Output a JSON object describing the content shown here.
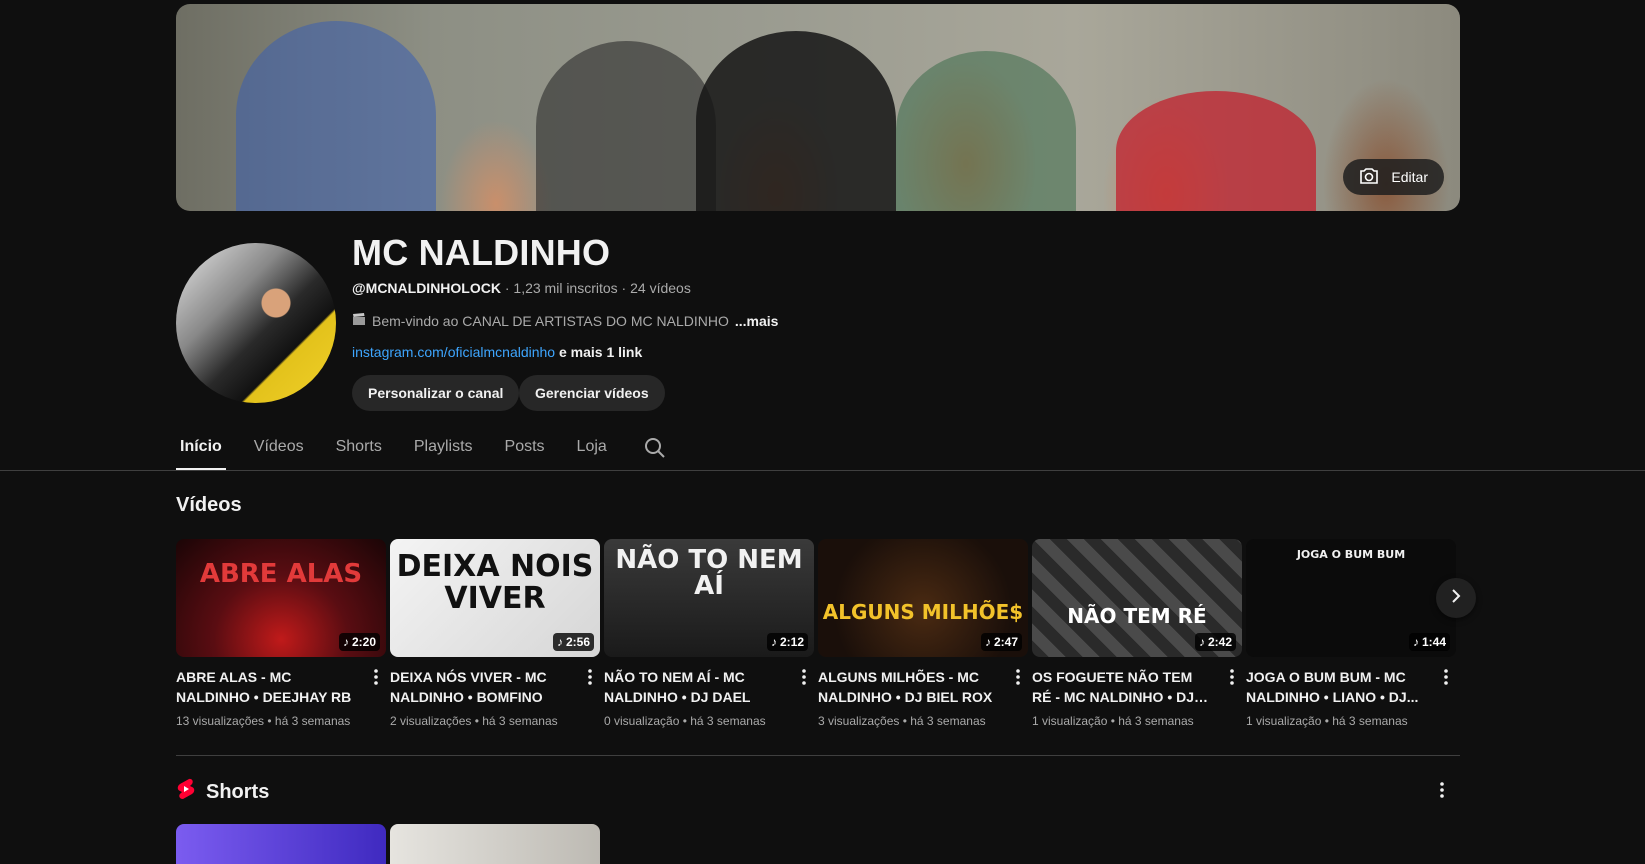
{
  "banner": {
    "edit_label": "Editar"
  },
  "channel": {
    "name": "MC NALDINHO",
    "handle": "@MCNALDINHOLOCK",
    "stats": " · 1,23 mil inscritos · 24 vídeos",
    "description": "Bem-vindo ao CANAL DE ARTISTAS DO MC NALDINHO",
    "description_more": "...mais",
    "link": "instagram.com/oficialmcnaldinho",
    "more_links": "e mais 1 link"
  },
  "actions": {
    "customize": "Personalizar o canal",
    "manage": "Gerenciar vídeos"
  },
  "tabs": [
    "Início",
    "Vídeos",
    "Shorts",
    "Playlists",
    "Posts",
    "Loja"
  ],
  "videos_section": {
    "title": "Vídeos"
  },
  "videos": [
    {
      "title": "ABRE ALAS - MC NALDINHO • DEEJHAY RB",
      "stats": "13 visualizações • há 3 semanas",
      "duration": "2:20",
      "thumb_text": "ABRE ALAS",
      "thumb_bg": "#5a0d12",
      "thumb_fg": "#e23a3a"
    },
    {
      "title": "DEIXA NÓS VIVER - MC NALDINHO • BOMFINO",
      "stats": "2 visualizações • há 3 semanas",
      "duration": "2:56",
      "thumb_text": "DEIXA NOIS VIVER",
      "thumb_bg": "#e9e9e9",
      "thumb_fg": "#111111"
    },
    {
      "title": "NÃO TO NEM AÍ - MC NALDINHO • DJ DAEL",
      "stats": "0 visualização • há 3 semanas",
      "duration": "2:12",
      "thumb_text": "NÃO TO NEM AÍ",
      "thumb_bg": "#2a2a2a",
      "thumb_fg": "#f1f1f1"
    },
    {
      "title": "ALGUNS MILHÕES - MC NALDINHO • DJ BIEL ROX",
      "stats": "3 visualizações • há 3 semanas",
      "duration": "2:47",
      "thumb_text": "ALGUNS MILHÕE$",
      "thumb_bg": "#1a0f0a",
      "thumb_fg": "#f2c22a"
    },
    {
      "title": "OS FOGUETE NÃO TEM RÉ - MC NALDINHO • DJ AK...",
      "stats": "1 visualização • há 3 semanas",
      "duration": "2:42",
      "thumb_text": "NÃO TEM RÉ",
      "thumb_bg": "#3a3a3a",
      "thumb_fg": "#ffffff"
    },
    {
      "title": "JOGA O BUM BUM - MC NALDINHO • LIANO • DJ...",
      "stats": "1 visualização • há 3 semanas",
      "duration": "1:44",
      "thumb_text": "JOGA O BUM BUM",
      "thumb_bg": "#0b0b0b",
      "thumb_fg": "#f1f1f1"
    }
  ],
  "shorts_section": {
    "title": "Shorts"
  },
  "colors": {
    "background": "#0f0f0f",
    "link": "#3ea6ff",
    "chip": "#272727",
    "shorts_red": "#ff0033"
  }
}
